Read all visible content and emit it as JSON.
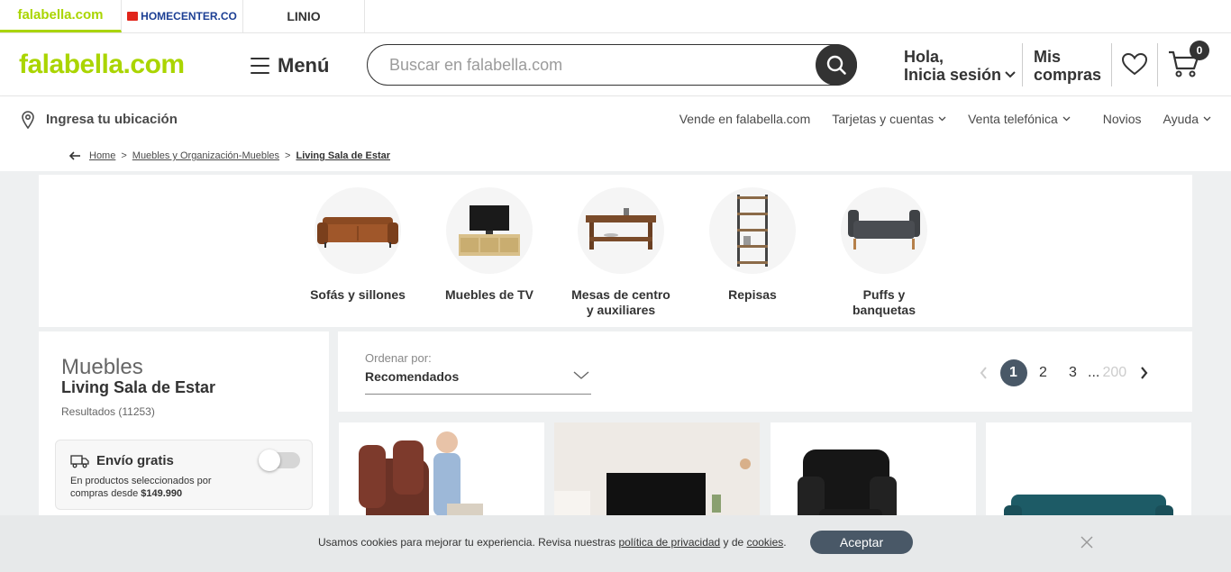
{
  "brand_tabs": [
    "falabella.com",
    "HOMECENTER.CO",
    "LINIO"
  ],
  "header": {
    "logo": "falabella.com",
    "menu_label": "Menú",
    "search_placeholder": "Buscar en falabella.com",
    "login_line1": "Hola,",
    "login_line2": "Inicia sesión",
    "purchases_line1": "Mis",
    "purchases_line2": "compras",
    "cart_count": "0"
  },
  "location_bar": {
    "location_label": "Ingresa tu ubicación",
    "links": [
      "Vende en falabella.com",
      "Tarjetas y cuentas",
      "Venta telefónica",
      "Novios",
      "Ayuda"
    ]
  },
  "breadcrumb": {
    "items": [
      "Home",
      "Muebles y Organización-Muebles",
      "Living Sala de Estar"
    ]
  },
  "categories": [
    {
      "line1": "Sofás y sillones",
      "line2": ""
    },
    {
      "line1": "Muebles de TV",
      "line2": ""
    },
    {
      "line1": "Mesas de centro",
      "line2": "y auxiliares"
    },
    {
      "line1": "Repisas",
      "line2": ""
    },
    {
      "line1": "Puffs y",
      "line2": "banquetas"
    }
  ],
  "sidebar": {
    "category_parent": "Muebles",
    "category_title": "Living Sala de Estar",
    "results": "Resultados (11253)",
    "free_shipping_title": "Envío gratis",
    "free_shipping_desc1": "En productos seleccionados por",
    "free_shipping_desc2_prefix": "compras desde ",
    "free_shipping_amount": "$149.990",
    "free_shipping_on": false
  },
  "sort": {
    "label": "Ordenar por:",
    "value": "Recomendados"
  },
  "pagination": {
    "pages": [
      "1",
      "2",
      "3"
    ],
    "ellipsis": "...",
    "last": "200",
    "current": "1"
  },
  "cookie": {
    "text_before": "Usamos cookies para mejorar tu experiencia. Revisa nuestras ",
    "privacy_link": "política de privacidad",
    "middle": " y de ",
    "cookies_link": "cookies",
    "end": ".",
    "accept": "Aceptar"
  },
  "colors": {
    "brand_green": "#aad500",
    "dark": "#333333",
    "pager_active": "#495867"
  }
}
